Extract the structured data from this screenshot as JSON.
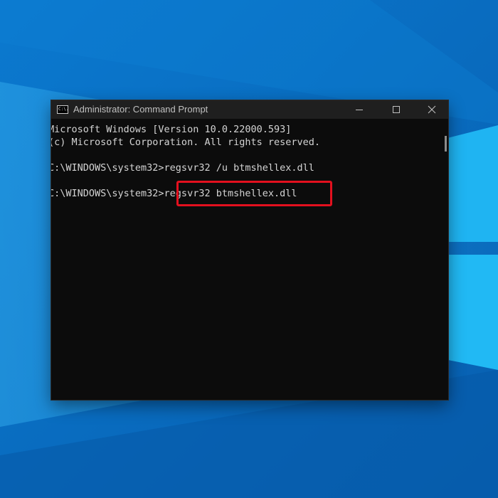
{
  "window": {
    "title": "Administrator: Command Prompt",
    "app_icon_text": "C:\\."
  },
  "console": {
    "lines": [
      "Microsoft Windows [Version 10.0.22000.593]",
      "(c) Microsoft Corporation. All rights reserved.",
      "",
      "C:\\WINDOWS\\system32>regsvr32 /u btmshellex.dll",
      "",
      "C:\\WINDOWS\\system32>regsvr32 btmshellex.dll"
    ]
  },
  "icons": {
    "app": "cmd-icon",
    "minimize": "minimize-icon",
    "maximize": "maximize-icon",
    "close": "close-icon",
    "desktop_logo": "windows-logo-icon"
  },
  "colors": {
    "desktop_background": "#0a72c4",
    "terminal_background": "#0c0c0c",
    "terminal_text": "#d4d4d4",
    "highlight": "#e3101e"
  }
}
